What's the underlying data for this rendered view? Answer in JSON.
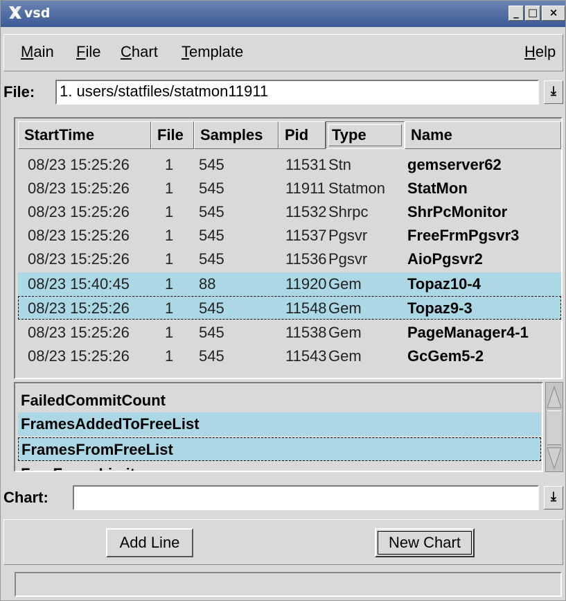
{
  "window": {
    "title": "vsd",
    "controls": [
      "_",
      "□",
      "×"
    ]
  },
  "menubar": {
    "items": [
      {
        "underline": "M",
        "rest": "ain"
      },
      {
        "underline": "F",
        "rest": "ile"
      },
      {
        "underline": "C",
        "rest": "hart"
      },
      {
        "underline": "T",
        "rest": "emplate"
      }
    ],
    "help": {
      "underline": "H",
      "rest": "elp"
    }
  },
  "file": {
    "label": "File:",
    "value": "1. users/statfiles/statmon11911"
  },
  "table": {
    "headers": [
      "StartTime",
      "File",
      "Samples",
      "Pid",
      "Type",
      "Name"
    ],
    "rows": [
      [
        "08/23 15:25:26",
        "1",
        "545",
        "11531",
        "Stn",
        "gemserver62"
      ],
      [
        "08/23 15:25:26",
        "1",
        "545",
        "11911",
        "Statmon",
        "StatMon"
      ],
      [
        "08/23 15:25:26",
        "1",
        "545",
        "11532",
        "Shrpc",
        "ShrPcMonitor"
      ],
      [
        "08/23 15:25:26",
        "1",
        "545",
        "11537",
        "Pgsvr",
        "FreeFrmPgsvr3"
      ],
      [
        "08/23 15:25:26",
        "1",
        "545",
        "11536",
        "Pgsvr",
        "AioPgsvr2"
      ],
      [
        "08/23 15:40:45",
        "1",
        "88",
        "11920",
        "Gem",
        "Topaz10-4"
      ],
      [
        "08/23 15:25:26",
        "1",
        "545",
        "11548",
        "Gem",
        "Topaz9-3"
      ],
      [
        "08/23 15:25:26",
        "1",
        "545",
        "11538",
        "Gem",
        "PageManager4-1"
      ],
      [
        "08/23 15:25:26",
        "1",
        "545",
        "11543",
        "Gem",
        "GcGem5-2"
      ]
    ]
  },
  "stats": {
    "items": [
      "FailedCommitCount",
      "FramesAddedToFreeList",
      "FramesFromFreeList",
      "FreeFrameLimit"
    ]
  },
  "chart": {
    "label": "Chart:",
    "value": ""
  },
  "buttons": {
    "add_line": "Add Line",
    "new_chart": "New Chart"
  },
  "colors": {
    "selection": "#acd8e6",
    "titlebar": "#3b5a94"
  }
}
